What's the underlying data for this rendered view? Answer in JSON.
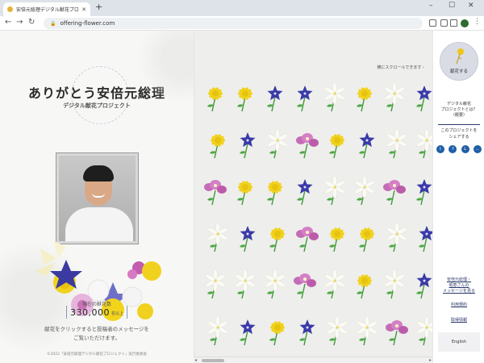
{
  "browser": {
    "tab_title": "安倍元総理デジタル献花プロ…",
    "tab_close": "✕",
    "new_tab": "+",
    "url": "offering-flower.com",
    "minimize": "–",
    "maximize": "☐",
    "close": "✕"
  },
  "left": {
    "title": "ありがとう安倍元総理",
    "subtitle": "デジタル献花プロジェクト",
    "count_label": "現在の献花数",
    "count_value": "330,000",
    "count_suffix": "名以上",
    "message_line1": "献花をクリックすると投稿者のメッセージを",
    "message_line2": "ご覧いただけます。",
    "copyright": "©2022「安倍元総理デジタル献花プロジェクト」実行委員会"
  },
  "mid": {
    "scroll_hint": "横にスクロールできます ›"
  },
  "right": {
    "kenka_label": "献花する",
    "about_line1": "デジタル献花",
    "about_line2": "プロジェクトとは？",
    "about_line3": "（概要）",
    "share_line1": "このプロジェクトを",
    "share_line2": "シェアする",
    "share_icons": [
      "t",
      "f",
      "L",
      "…"
    ],
    "link_message_line1": "安倍元総理・",
    "link_message_line2": "昭恵さんの",
    "link_message_line3": "メッセージを見る",
    "link_terms": "利用規約",
    "link_privacy": "取得情報",
    "english": "English"
  }
}
